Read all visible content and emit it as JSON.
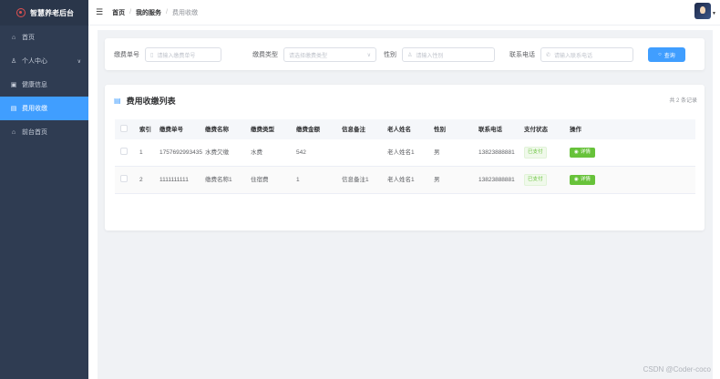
{
  "brand": {
    "title": "智慧养老后台"
  },
  "sidebar": {
    "items": [
      {
        "label": "首页",
        "icon": "home-icon"
      },
      {
        "label": "个人中心",
        "icon": "user-icon",
        "chevron": "∨"
      },
      {
        "label": "健康信息",
        "icon": "health-icon"
      },
      {
        "label": "费用收缴",
        "icon": "fee-icon",
        "active": true
      },
      {
        "label": "前台首页",
        "icon": "frontpage-icon"
      }
    ]
  },
  "header": {
    "breadcrumb": [
      "首页",
      "我的服务",
      "费用收缴"
    ],
    "separator": "/"
  },
  "search": {
    "fee_no": {
      "label": "缴费单号",
      "placeholder": "请输入缴费单号"
    },
    "fee_type": {
      "label": "缴费类型",
      "placeholder": "请选择缴费类型"
    },
    "gender": {
      "label": "性别",
      "placeholder": "请输入性别"
    },
    "phone": {
      "label": "联系电话",
      "placeholder": "请输入联系电话"
    },
    "query_label": "查询"
  },
  "list": {
    "title": "费用收缴列表",
    "total": "共 2 条记录",
    "columns": [
      "索引",
      "缴费单号",
      "缴费名称",
      "缴费类型",
      "缴费金额",
      "信息备注",
      "老人姓名",
      "性别",
      "联系电话",
      "支付状态",
      "操作"
    ],
    "rows": [
      {
        "index": "1",
        "fee_no": "1757692993435",
        "fee_name": "水费欠缴",
        "fee_type": "水费",
        "amount": "542",
        "remark": "",
        "elder": "老人姓名1",
        "sex": "男",
        "phone": "13823888881",
        "status": "已支付",
        "action": "详情"
      },
      {
        "index": "2",
        "fee_no": "1111111111",
        "fee_name": "缴费名称1",
        "fee_type": "住宿费",
        "amount": "1",
        "remark": "信息备注1",
        "elder": "老人姓名1",
        "sex": "男",
        "phone": "13823888881",
        "status": "已支付",
        "action": "详情"
      }
    ]
  },
  "watermark": "CSDN @Coder-coco",
  "colors": {
    "sidebar": "#2f3c52",
    "accent": "#409eff",
    "success": "#67c23a"
  }
}
